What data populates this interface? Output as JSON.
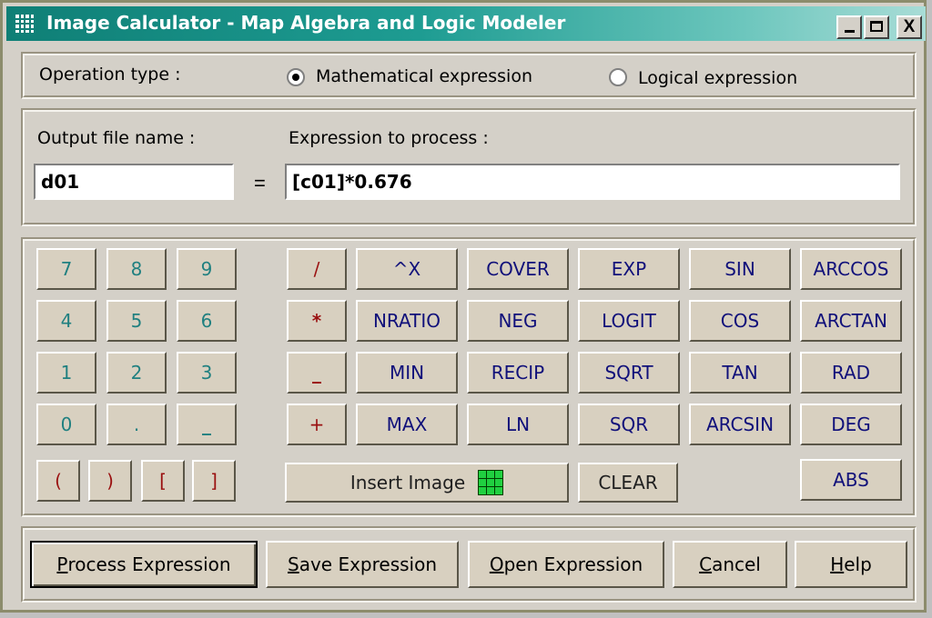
{
  "window": {
    "title": "Image Calculator - Map  Algebra and Logic Modeler",
    "controls": {
      "minimize_icon": "minimize-icon",
      "maximize_icon": "maximize-icon",
      "close_label": "X"
    }
  },
  "operation": {
    "label": "Operation type :",
    "options": [
      {
        "label": "Mathematical expression",
        "checked": true
      },
      {
        "label": "Logical expression",
        "checked": false
      }
    ]
  },
  "expression": {
    "output_label": "Output file name :",
    "output_value": "d01",
    "equals": "=",
    "expression_label": "Expression to process :",
    "expression_value": "[c01]*0.676"
  },
  "keypad": {
    "digits": [
      "7",
      "8",
      "9",
      "4",
      "5",
      "6",
      "1",
      "2",
      "3",
      "0",
      ".",
      "_"
    ],
    "brackets": [
      "(",
      ")",
      "[",
      "]"
    ],
    "operators": [
      "/",
      "*",
      "_",
      "+"
    ],
    "functions": {
      "col1": [
        "^X",
        "NRATIO",
        "MIN",
        "MAX"
      ],
      "col2": [
        "COVER",
        "NEG",
        "RECIP",
        "LN"
      ],
      "col3": [
        "EXP",
        "LOGIT",
        "SQRT",
        "SQR"
      ],
      "col4": [
        "SIN",
        "COS",
        "TAN",
        "ARCSIN"
      ],
      "col5": [
        "ARCCOS",
        "ARCTAN",
        "RAD",
        "DEG"
      ]
    },
    "insert_image": "Insert Image",
    "clear": "CLEAR",
    "abs": "ABS"
  },
  "actions": {
    "process": {
      "mnemonic": "P",
      "rest": "rocess Expression"
    },
    "save": {
      "mnemonic": "S",
      "rest": "ave Expression"
    },
    "open": {
      "mnemonic": "O",
      "rest": "pen Expression"
    },
    "cancel": {
      "mnemonic": "C",
      "rest": "ancel"
    },
    "help": {
      "mnemonic": "H",
      "rest": "elp"
    }
  },
  "colors": {
    "titlebar": "#0f7f76",
    "digit_text": "#208080",
    "operator_text": "#9a1010",
    "function_text": "#10107a",
    "insert_icon": "#20d040"
  }
}
